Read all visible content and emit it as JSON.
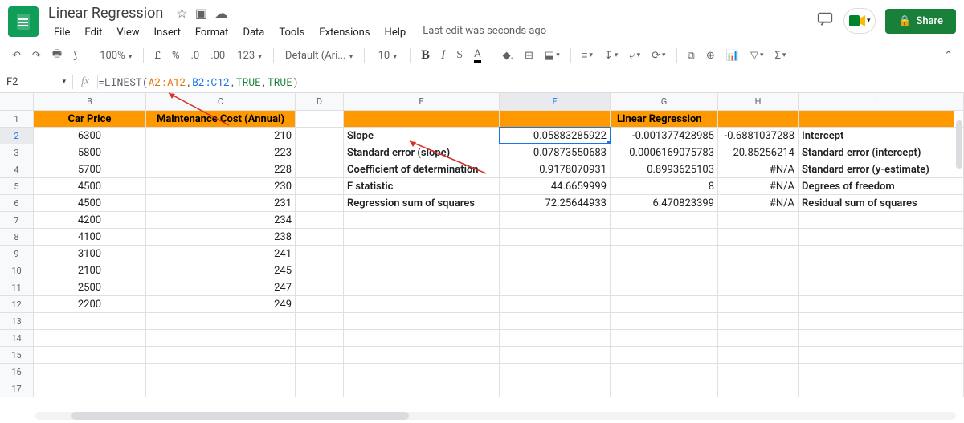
{
  "doc_title": "Linear Regression",
  "menus": [
    "File",
    "Edit",
    "View",
    "Insert",
    "Format",
    "Data",
    "Tools",
    "Extensions",
    "Help"
  ],
  "last_edit": "Last edit was seconds ago",
  "share_label": "Share",
  "toolbar": {
    "zoom": "100%",
    "currency": "£",
    "percent": "%",
    "dec_dec": ".0",
    "inc_dec": ".00",
    "more_formats": "123",
    "font": "Default (Ari...",
    "font_size": "10"
  },
  "name_box": "F2",
  "formula": {
    "prefix": "=LINEST(",
    "ref1": "A2:A12",
    "ref2": "B2:C12",
    "bool1": "TRUE",
    "bool2": "TRUE",
    "suffix": ")"
  },
  "columns": [
    "B",
    "C",
    "D",
    "E",
    "F",
    "G",
    "H",
    "I"
  ],
  "headers": {
    "B": "Car Price",
    "C": "Maintenance Cost (Annual)",
    "title": "Linear Regression"
  },
  "rows": [
    {
      "r": "1"
    },
    {
      "r": "2",
      "B": "6300",
      "C": "210",
      "E": "Slope",
      "F": "0.05883285922",
      "G": "-0.001377428985",
      "H": "-0.6881037288",
      "I": "Intercept"
    },
    {
      "r": "3",
      "B": "5800",
      "C": "223",
      "E": "Standard error (slope)",
      "F": "0.07873550683",
      "G": "0.0006169075783",
      "H": "20.85256214",
      "I": "Standard error (intercept)"
    },
    {
      "r": "4",
      "B": "5700",
      "C": "228",
      "E": "Coefficient of determination",
      "F": "0.9178070931",
      "G": "0.8993625103",
      "H": "#N/A",
      "I": "Standard error (y-estimate)"
    },
    {
      "r": "5",
      "B": "4500",
      "C": "230",
      "E": "F statistic",
      "F": "44.6659999",
      "G": "8",
      "H": "#N/A",
      "I": "Degrees of freedom"
    },
    {
      "r": "6",
      "B": "4500",
      "C": "231",
      "E": "Regression sum of squares",
      "F": "72.25644933",
      "G": "6.470823399",
      "H": "#N/A",
      "I": "Residual sum of squares"
    },
    {
      "r": "7",
      "B": "4200",
      "C": "234"
    },
    {
      "r": "8",
      "B": "4100",
      "C": "238"
    },
    {
      "r": "9",
      "B": "3100",
      "C": "241"
    },
    {
      "r": "10",
      "B": "2100",
      "C": "245"
    },
    {
      "r": "11",
      "B": "2500",
      "C": "247"
    },
    {
      "r": "12",
      "B": "2200",
      "C": "249"
    },
    {
      "r": "13"
    },
    {
      "r": "14"
    },
    {
      "r": "15"
    },
    {
      "r": "16"
    },
    {
      "r": "17"
    }
  ],
  "active_cell": "F2",
  "chart_data": {
    "type": "table",
    "title": "Linear Regression",
    "input_series": [
      {
        "name": "Car Price",
        "values": [
          6300,
          5800,
          5700,
          4500,
          4500,
          4200,
          4100,
          3100,
          2100,
          2500,
          2200
        ]
      },
      {
        "name": "Maintenance Cost (Annual)",
        "values": [
          210,
          223,
          228,
          230,
          231,
          234,
          238,
          241,
          245,
          247,
          249
        ]
      }
    ],
    "linest_output": {
      "slopes": [
        0.05883285922,
        -0.001377428985
      ],
      "intercept": -0.6881037288,
      "se_slopes": [
        0.07873550683,
        0.0006169075783
      ],
      "se_intercept": 20.85256214,
      "r_squared": 0.9178070931,
      "se_y": 0.8993625103,
      "f_statistic": 44.6659999,
      "degrees_of_freedom": 8,
      "ss_reg": 72.25644933,
      "ss_resid": 6.470823399
    }
  }
}
